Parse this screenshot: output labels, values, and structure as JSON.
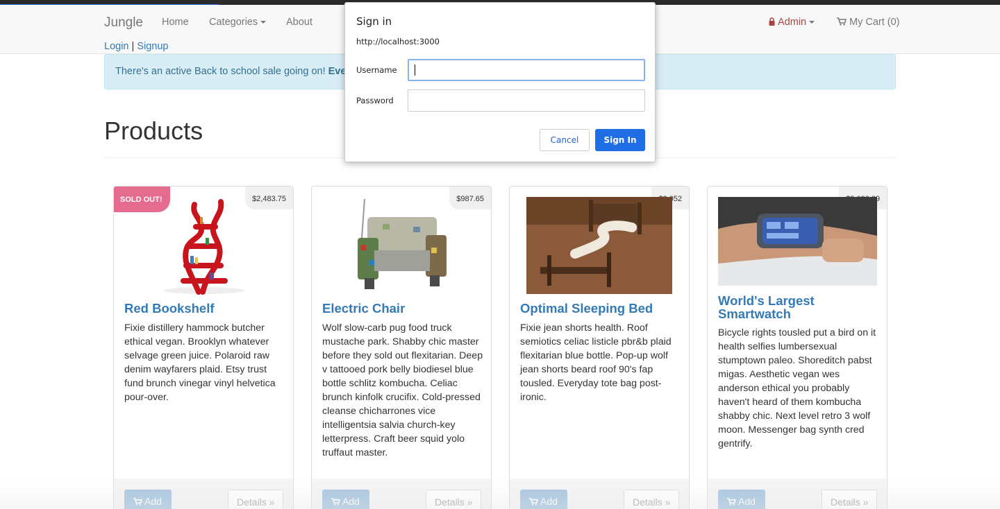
{
  "nav": {
    "brand": "Jungle",
    "home": "Home",
    "categories": "Categories",
    "about": "About",
    "admin": "Admin",
    "cart": "My Cart (0)"
  },
  "auth": {
    "login": "Login",
    "separator": "|",
    "signup": "Signup"
  },
  "alert": {
    "text": "There's an active Back to school sale going on! ",
    "bold": "Every"
  },
  "page_title": "Products",
  "products": [
    {
      "name": "Red Bookshelf",
      "price": "$2,483.75",
      "badge": "SOLD OUT!",
      "description": "Fixie distillery hammock butcher ethical vegan. Brooklyn whatever selvage green juice. Polaroid raw denim wayfarers plaid. Etsy trust fund brunch vinegar vinyl helvetica pour-over.",
      "add": "Add",
      "details": "Details »"
    },
    {
      "name": "Electric Chair",
      "price": "$987.65",
      "description": "Wolf slow-carb pug food truck mustache park. Shabby chic master before they sold out flexitarian. Deep v tattooed pork belly biodiesel blue bottle schlitz kombucha. Celiac brunch kinfolk crucifix. Cold-pressed cleanse chicharrones vice intelligentsia salvia church-key letterpress. Craft beer squid yolo truffaut master.",
      "add": "Add",
      "details": "Details »"
    },
    {
      "name": "Optimal Sleeping Bed",
      "price": "$3,052",
      "description": "Fixie jean shorts health. Roof semiotics celiac listicle pbr&b plaid flexitarian blue bottle. Pop-up wolf jean shorts beard roof 90's fap tousled. Everyday tote bag post-ironic.",
      "add": "Add",
      "details": "Details »"
    },
    {
      "name": "World's Largest Smartwatch",
      "price": "$2,026.29",
      "description": "Bicycle rights tousled put a bird on it health selfies lumbersexual stumptown paleo. Shoreditch pabst migas. Aesthetic vegan wes anderson ethical you probably haven't heard of them kombucha shabby chic. Next level retro 3 wolf moon. Messenger bag synth cred gentrify.",
      "add": "Add",
      "details": "Details »"
    }
  ],
  "dialog": {
    "title": "Sign in",
    "url": "http://localhost:3000",
    "username_label": "Username",
    "password_label": "Password",
    "username_value": "",
    "password_value": "",
    "cancel": "Cancel",
    "signin": "Sign In"
  },
  "colors": {
    "link": "#337ab7",
    "sold_out": "#e56b8f",
    "primary_button": "#1f6ee6",
    "alert_bg": "#d9edf7"
  }
}
